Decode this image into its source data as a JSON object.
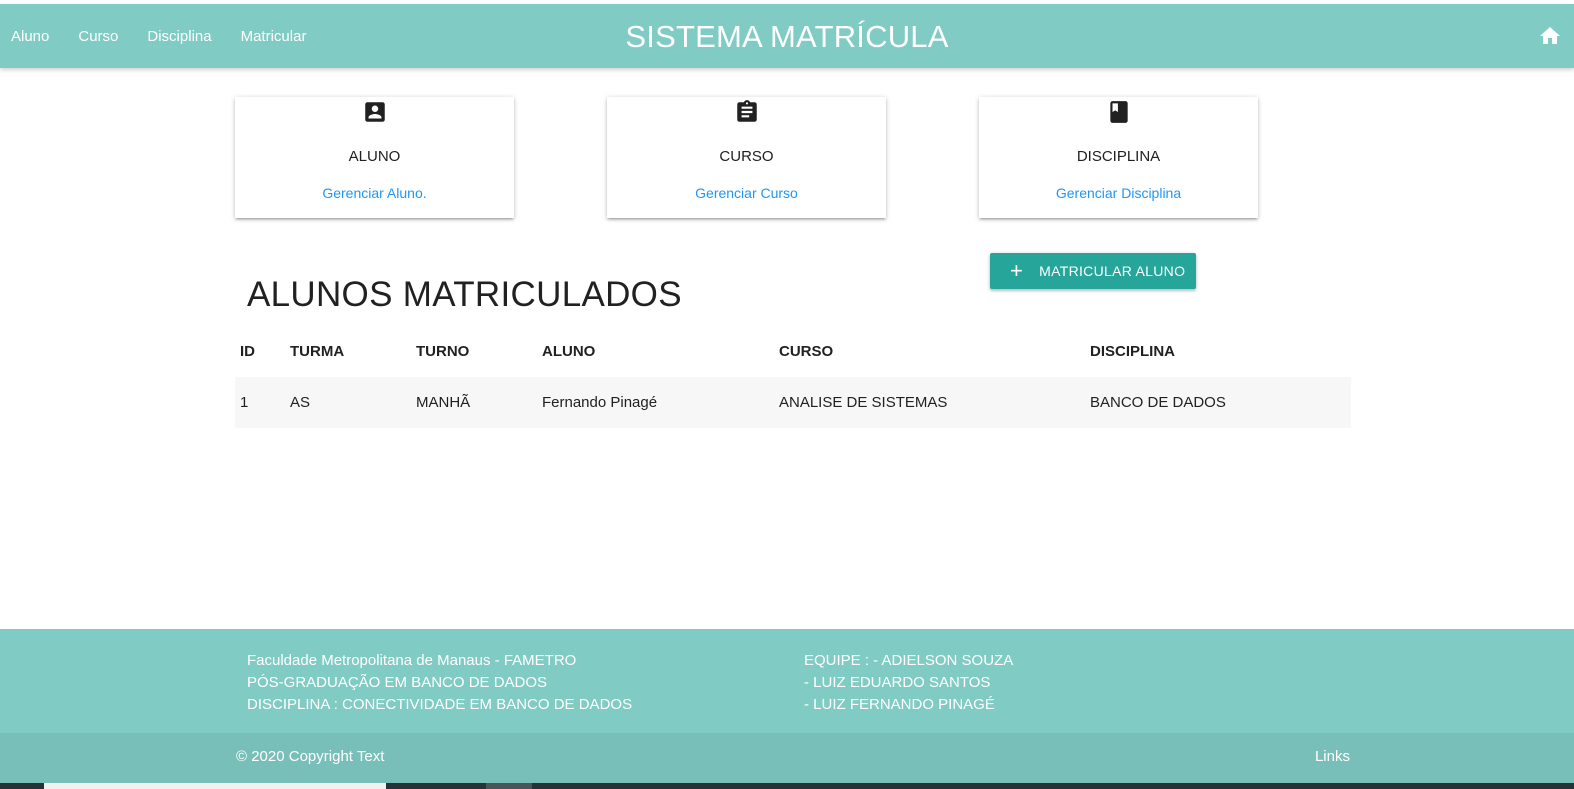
{
  "navbar": {
    "links": [
      "Aluno",
      "Curso",
      "Disciplina",
      "Matricular"
    ],
    "brand": "SISTEMA MATRÍCULA",
    "home_icon": "home-icon"
  },
  "cards": [
    {
      "icon": "account-box-icon",
      "title": "ALUNO",
      "link": "Gerenciar Aluno."
    },
    {
      "icon": "assignment-icon",
      "title": "CURSO",
      "link": "Gerenciar Curso"
    },
    {
      "icon": "book-icon",
      "title": "DISCIPLINA",
      "link": "Gerenciar Disciplina"
    }
  ],
  "enroll_button": {
    "icon": "+",
    "label": "MATRICULAR ALUNO"
  },
  "section_title": "ALUNOS MATRICULADOS",
  "table": {
    "headers": [
      "ID",
      "TURMA",
      "TURNO",
      "ALUNO",
      "CURSO",
      "DISCIPLINA"
    ],
    "rows": [
      [
        "1",
        "AS",
        "MANHÃ",
        "Fernando Pinagé",
        "ANALISE DE SISTEMAS",
        "BANCO DE DADOS"
      ]
    ]
  },
  "footer": {
    "left_lines": [
      "Faculdade Metropolitana de Manaus - FAMETRO",
      "PÓS-GRADUAÇÃO EM BANCO DE DADOS",
      "DISCIPLINA : CONECTIVIDADE EM BANCO DE DADOS"
    ],
    "right_lines": [
      "EQUIPE : - ADIELSON SOUZA",
      "- LUIZ EDUARDO SANTOS",
      "- LUIZ FERNANDO PINAGÉ"
    ],
    "copyright": "© 2020 Copyright Text",
    "links": "Links"
  },
  "colors": {
    "primary": "#80cbc4",
    "button": "#26a69a",
    "link": "#2196f3"
  }
}
